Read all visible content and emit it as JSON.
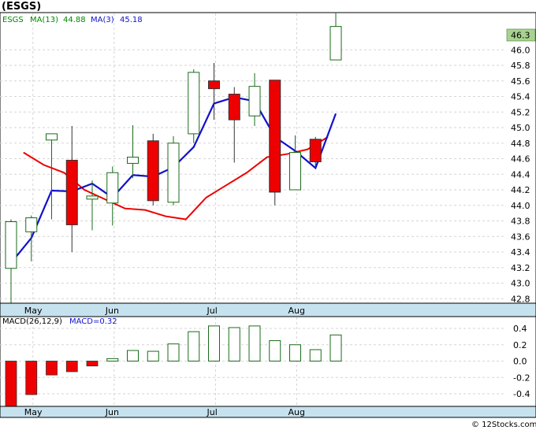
{
  "title": "(ESGS)",
  "legend": {
    "symbol": "ESGS",
    "ma13_label": "MA(13)",
    "ma13_value": "44.88",
    "ma3_label": "MA(3)",
    "ma3_value": "45.18"
  },
  "macd_legend": {
    "label": "MACD(26,12,9)",
    "value_text": "MACD=0.32"
  },
  "last_price_tag": "46.3",
  "credit": "© 12Stocks.com",
  "colors": {
    "up_candle": "#1a6b1a",
    "down_candle": "#ee0000",
    "ma13": "#ee0000",
    "ma3": "#1111cc",
    "macd_bar_pos": "#1a6b1a",
    "macd_bar_neg": "#ee0000",
    "axis_band": "#c6e2ee",
    "grid": "#d6d6d6",
    "legend_symbol": "#008800",
    "legend_ma13": "#008800",
    "legend_ma3": "#1111cc"
  },
  "chart_data": [
    {
      "type": "candlestick",
      "title": "(ESGS)",
      "ylim": [
        42.6,
        46.5
      ],
      "y_ticks": [
        "42.8",
        "43.0",
        "43.2",
        "43.4",
        "43.6",
        "43.8",
        "44.0",
        "44.2",
        "44.4",
        "44.6",
        "44.8",
        "45.0",
        "45.2",
        "45.4",
        "45.6",
        "45.8",
        "46.0"
      ],
      "month_labels": [
        {
          "label": "May",
          "bar": 1
        },
        {
          "label": "Jun",
          "bar": 5
        },
        {
          "label": "Jul",
          "bar": 10
        },
        {
          "label": "Aug",
          "bar": 14
        }
      ],
      "candles": [
        {
          "open": 43.19,
          "high": 43.82,
          "low": 42.7,
          "close": 43.79
        },
        {
          "open": 43.66,
          "high": 43.87,
          "low": 43.28,
          "close": 43.84
        },
        {
          "open": 44.84,
          "high": 44.92,
          "low": 43.82,
          "close": 44.92
        },
        {
          "open": 44.58,
          "high": 45.02,
          "low": 43.4,
          "close": 43.75
        },
        {
          "open": 44.08,
          "high": 44.32,
          "low": 43.68,
          "close": 44.12
        },
        {
          "open": 44.03,
          "high": 44.5,
          "low": 43.74,
          "close": 44.42
        },
        {
          "open": 44.54,
          "high": 45.03,
          "low": 44.35,
          "close": 44.62
        },
        {
          "open": 44.83,
          "high": 44.92,
          "low": 44.0,
          "close": 44.06
        },
        {
          "open": 44.04,
          "high": 44.89,
          "low": 44.0,
          "close": 44.8
        },
        {
          "open": 44.92,
          "high": 45.75,
          "low": 44.8,
          "close": 45.71
        },
        {
          "open": 45.6,
          "high": 45.83,
          "low": 45.1,
          "close": 45.5
        },
        {
          "open": 45.43,
          "high": 45.52,
          "low": 44.55,
          "close": 45.1
        },
        {
          "open": 45.15,
          "high": 45.7,
          "low": 45.02,
          "close": 45.53
        },
        {
          "open": 45.61,
          "high": 45.61,
          "low": 44.0,
          "close": 44.17
        },
        {
          "open": 44.2,
          "high": 44.9,
          "low": 44.2,
          "close": 44.68
        },
        {
          "open": 44.85,
          "high": 44.88,
          "low": 44.48,
          "close": 44.56
        },
        {
          "open": 45.87,
          "high": 46.48,
          "low": 45.87,
          "close": 46.3
        }
      ],
      "series": [
        {
          "name": "MA(13)",
          "values": [
            44.68,
            44.52,
            44.42,
            44.2,
            44.08,
            43.96,
            43.94,
            43.86,
            43.82,
            44.1,
            44.26,
            44.42,
            44.62,
            44.66,
            44.72,
            44.88
          ]
        },
        {
          "name": "MA(3)",
          "values": [
            43.26,
            43.58,
            44.19,
            44.18,
            44.28,
            44.1,
            44.39,
            44.37,
            44.49,
            44.75,
            45.31,
            45.39,
            45.34,
            44.88,
            44.7,
            44.48,
            45.18
          ]
        }
      ],
      "ma13_offset": 1
    },
    {
      "type": "bar",
      "title": "MACD(26,12,9)",
      "ylim": [
        -0.58,
        0.5
      ],
      "y_ticks": [
        "0.4",
        "0.2",
        "0.0",
        "-0.2",
        "-0.4"
      ],
      "values": [
        -0.56,
        -0.41,
        -0.17,
        -0.13,
        -0.06,
        0.03,
        0.13,
        0.12,
        0.21,
        0.36,
        0.43,
        0.41,
        0.43,
        0.25,
        0.2,
        0.14,
        0.32
      ],
      "month_labels": [
        {
          "label": "May",
          "bar": 1
        },
        {
          "label": "Jun",
          "bar": 5
        },
        {
          "label": "Jul",
          "bar": 10
        },
        {
          "label": "Aug",
          "bar": 14
        }
      ]
    }
  ]
}
